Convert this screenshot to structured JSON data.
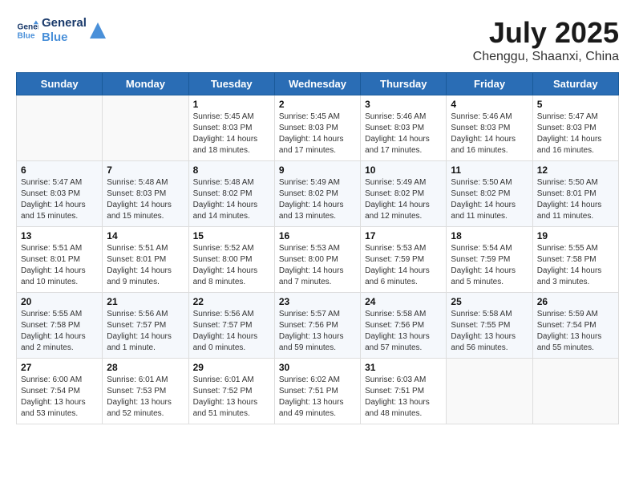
{
  "header": {
    "logo_line1": "General",
    "logo_line2": "Blue",
    "main_title": "July 2025",
    "subtitle": "Chenggu, Shaanxi, China"
  },
  "columns": [
    "Sunday",
    "Monday",
    "Tuesday",
    "Wednesday",
    "Thursday",
    "Friday",
    "Saturday"
  ],
  "weeks": [
    [
      {
        "day": "",
        "info": ""
      },
      {
        "day": "",
        "info": ""
      },
      {
        "day": "1",
        "info": "Sunrise: 5:45 AM\nSunset: 8:03 PM\nDaylight: 14 hours\nand 18 minutes."
      },
      {
        "day": "2",
        "info": "Sunrise: 5:45 AM\nSunset: 8:03 PM\nDaylight: 14 hours\nand 17 minutes."
      },
      {
        "day": "3",
        "info": "Sunrise: 5:46 AM\nSunset: 8:03 PM\nDaylight: 14 hours\nand 17 minutes."
      },
      {
        "day": "4",
        "info": "Sunrise: 5:46 AM\nSunset: 8:03 PM\nDaylight: 14 hours\nand 16 minutes."
      },
      {
        "day": "5",
        "info": "Sunrise: 5:47 AM\nSunset: 8:03 PM\nDaylight: 14 hours\nand 16 minutes."
      }
    ],
    [
      {
        "day": "6",
        "info": "Sunrise: 5:47 AM\nSunset: 8:03 PM\nDaylight: 14 hours\nand 15 minutes."
      },
      {
        "day": "7",
        "info": "Sunrise: 5:48 AM\nSunset: 8:03 PM\nDaylight: 14 hours\nand 15 minutes."
      },
      {
        "day": "8",
        "info": "Sunrise: 5:48 AM\nSunset: 8:02 PM\nDaylight: 14 hours\nand 14 minutes."
      },
      {
        "day": "9",
        "info": "Sunrise: 5:49 AM\nSunset: 8:02 PM\nDaylight: 14 hours\nand 13 minutes."
      },
      {
        "day": "10",
        "info": "Sunrise: 5:49 AM\nSunset: 8:02 PM\nDaylight: 14 hours\nand 12 minutes."
      },
      {
        "day": "11",
        "info": "Sunrise: 5:50 AM\nSunset: 8:02 PM\nDaylight: 14 hours\nand 11 minutes."
      },
      {
        "day": "12",
        "info": "Sunrise: 5:50 AM\nSunset: 8:01 PM\nDaylight: 14 hours\nand 11 minutes."
      }
    ],
    [
      {
        "day": "13",
        "info": "Sunrise: 5:51 AM\nSunset: 8:01 PM\nDaylight: 14 hours\nand 10 minutes."
      },
      {
        "day": "14",
        "info": "Sunrise: 5:51 AM\nSunset: 8:01 PM\nDaylight: 14 hours\nand 9 minutes."
      },
      {
        "day": "15",
        "info": "Sunrise: 5:52 AM\nSunset: 8:00 PM\nDaylight: 14 hours\nand 8 minutes."
      },
      {
        "day": "16",
        "info": "Sunrise: 5:53 AM\nSunset: 8:00 PM\nDaylight: 14 hours\nand 7 minutes."
      },
      {
        "day": "17",
        "info": "Sunrise: 5:53 AM\nSunset: 7:59 PM\nDaylight: 14 hours\nand 6 minutes."
      },
      {
        "day": "18",
        "info": "Sunrise: 5:54 AM\nSunset: 7:59 PM\nDaylight: 14 hours\nand 5 minutes."
      },
      {
        "day": "19",
        "info": "Sunrise: 5:55 AM\nSunset: 7:58 PM\nDaylight: 14 hours\nand 3 minutes."
      }
    ],
    [
      {
        "day": "20",
        "info": "Sunrise: 5:55 AM\nSunset: 7:58 PM\nDaylight: 14 hours\nand 2 minutes."
      },
      {
        "day": "21",
        "info": "Sunrise: 5:56 AM\nSunset: 7:57 PM\nDaylight: 14 hours\nand 1 minute."
      },
      {
        "day": "22",
        "info": "Sunrise: 5:56 AM\nSunset: 7:57 PM\nDaylight: 14 hours\nand 0 minutes."
      },
      {
        "day": "23",
        "info": "Sunrise: 5:57 AM\nSunset: 7:56 PM\nDaylight: 13 hours\nand 59 minutes."
      },
      {
        "day": "24",
        "info": "Sunrise: 5:58 AM\nSunset: 7:56 PM\nDaylight: 13 hours\nand 57 minutes."
      },
      {
        "day": "25",
        "info": "Sunrise: 5:58 AM\nSunset: 7:55 PM\nDaylight: 13 hours\nand 56 minutes."
      },
      {
        "day": "26",
        "info": "Sunrise: 5:59 AM\nSunset: 7:54 PM\nDaylight: 13 hours\nand 55 minutes."
      }
    ],
    [
      {
        "day": "27",
        "info": "Sunrise: 6:00 AM\nSunset: 7:54 PM\nDaylight: 13 hours\nand 53 minutes."
      },
      {
        "day": "28",
        "info": "Sunrise: 6:01 AM\nSunset: 7:53 PM\nDaylight: 13 hours\nand 52 minutes."
      },
      {
        "day": "29",
        "info": "Sunrise: 6:01 AM\nSunset: 7:52 PM\nDaylight: 13 hours\nand 51 minutes."
      },
      {
        "day": "30",
        "info": "Sunrise: 6:02 AM\nSunset: 7:51 PM\nDaylight: 13 hours\nand 49 minutes."
      },
      {
        "day": "31",
        "info": "Sunrise: 6:03 AM\nSunset: 7:51 PM\nDaylight: 13 hours\nand 48 minutes."
      },
      {
        "day": "",
        "info": ""
      },
      {
        "day": "",
        "info": ""
      }
    ]
  ]
}
